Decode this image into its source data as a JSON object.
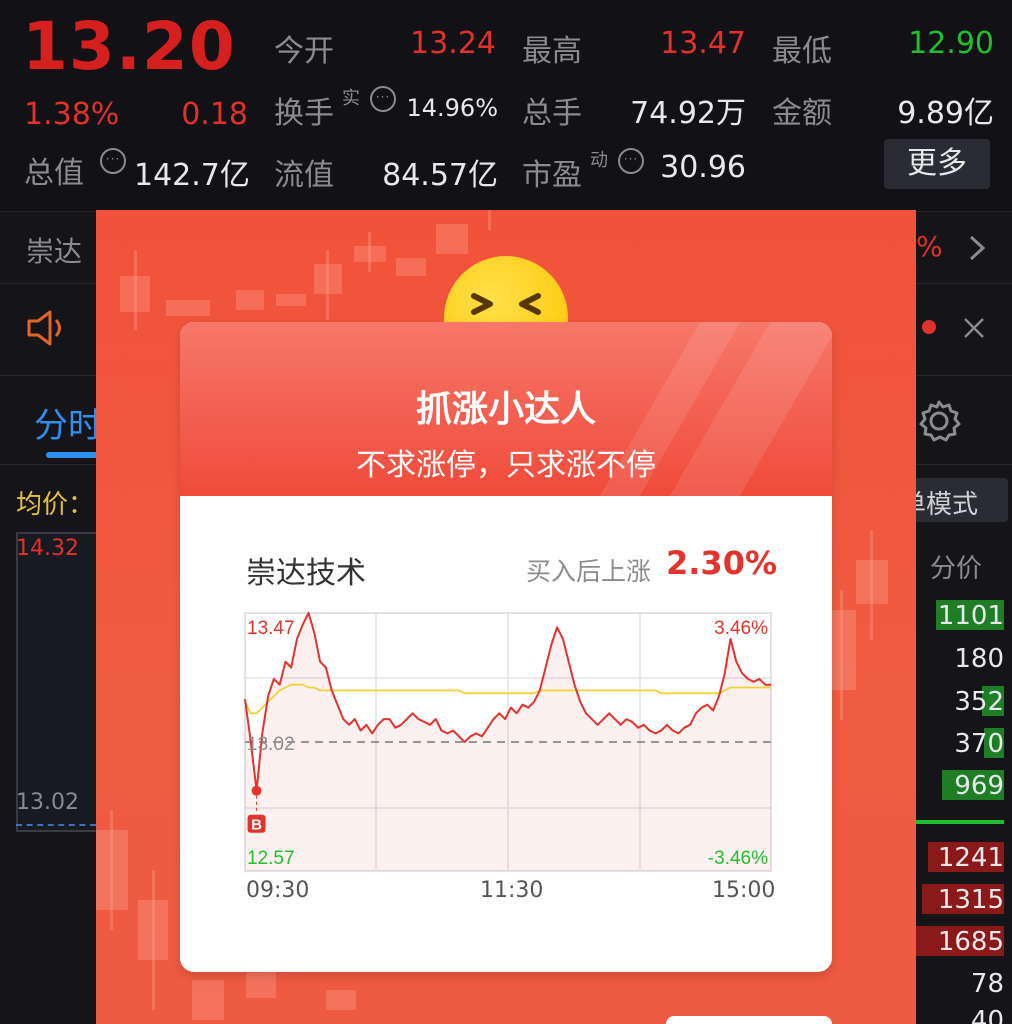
{
  "quote": {
    "price": "13.20",
    "change_pct": "1.38%",
    "change_abs": "0.18",
    "open_label": "今开",
    "open_value": "13.24",
    "high_label": "最高",
    "high_value": "13.47",
    "low_label": "最低",
    "low_value": "12.90",
    "turnover_label": "换手",
    "turnover_sup": "实",
    "turnover_value": "14.96%",
    "volume_label": "总手",
    "volume_value": "74.92万",
    "amount_label": "金额",
    "amount_value": "9.89亿",
    "mktcap_label": "总值",
    "mktcap_value": "142.7亿",
    "float_label": "流值",
    "float_value": "84.57亿",
    "pe_label": "市盈",
    "pe_sup": "动",
    "pe_value": "30.96",
    "more_label": "更多"
  },
  "background": {
    "row1_left": "崇达",
    "row1_right": "%",
    "tab_left": "分时",
    "avg_label": "均价：",
    "mode_label": "单模式",
    "detail_col": "分价",
    "left_price_high": "14.32",
    "left_price_base": "13.02",
    "right_values": [
      "1101",
      "180",
      "352",
      "370",
      "969",
      "1241",
      "1315",
      "1685",
      "78",
      "40"
    ]
  },
  "popup": {
    "title": "抓涨小达人",
    "subtitle": "不求涨停，只求涨不停",
    "stock_name": "崇达技术",
    "gain_label": "买入后上涨",
    "gain_value": "2.30%",
    "buy_marker": "B",
    "colors": {
      "up": "#e2332c",
      "down": "#1fbf2e",
      "avg_line": "#f2d23a"
    }
  },
  "chart_data": {
    "type": "line",
    "x_ticks": [
      "09:30",
      "11:30",
      "15:00"
    ],
    "y_max_label": "13.47",
    "y_min_label": "12.57",
    "y_base_label": "13.02",
    "pct_max_label": "3.46%",
    "pct_min_label": "-3.46%",
    "ylim": [
      12.57,
      13.47
    ],
    "baseline": 13.02,
    "series": [
      {
        "values": [
          13.17,
          13.02,
          12.85,
          13.05,
          13.18,
          13.24,
          13.22,
          13.3,
          13.28,
          13.38,
          13.43,
          13.47,
          13.4,
          13.3,
          13.28,
          13.2,
          13.15,
          13.1,
          13.08,
          13.1,
          13.06,
          13.08,
          13.05,
          13.08,
          13.1,
          13.1,
          13.07,
          13.08,
          13.1,
          13.12,
          13.1,
          13.09,
          13.08,
          13.1,
          13.06,
          13.05,
          13.06,
          13.04,
          13.02,
          13.04,
          13.05,
          13.04,
          13.07,
          13.1,
          13.12,
          13.1,
          13.14,
          13.12,
          13.15,
          13.14,
          13.16,
          13.2,
          13.28,
          13.36,
          13.42,
          13.38,
          13.3,
          13.22,
          13.16,
          13.12,
          13.1,
          13.08,
          13.1,
          13.12,
          13.1,
          13.08,
          13.1,
          13.09,
          13.07,
          13.08,
          13.06,
          13.05,
          13.06,
          13.08,
          13.06,
          13.05,
          13.07,
          13.08,
          13.12,
          13.14,
          13.15,
          13.13,
          13.18,
          13.26,
          13.38,
          13.3,
          13.26,
          13.24,
          13.23,
          13.24,
          13.22,
          13.22
        ]
      },
      {
        "values": [
          13.16,
          13.12,
          13.12,
          13.14,
          13.16,
          13.18,
          13.2,
          13.21,
          13.22,
          13.22,
          13.22,
          13.21,
          13.21,
          13.2,
          13.2,
          13.2,
          13.2,
          13.2,
          13.2,
          13.2,
          13.2,
          13.2,
          13.2,
          13.2,
          13.2,
          13.2,
          13.2,
          13.2,
          13.2,
          13.2,
          13.2,
          13.2,
          13.2,
          13.2,
          13.2,
          13.2,
          13.2,
          13.2,
          13.19,
          13.19,
          13.19,
          13.19,
          13.19,
          13.19,
          13.19,
          13.19,
          13.19,
          13.19,
          13.19,
          13.19,
          13.19,
          13.2,
          13.2,
          13.2,
          13.2,
          13.2,
          13.2,
          13.2,
          13.2,
          13.2,
          13.2,
          13.2,
          13.2,
          13.2,
          13.2,
          13.2,
          13.2,
          13.2,
          13.2,
          13.2,
          13.2,
          13.2,
          13.19,
          13.19,
          13.19,
          13.19,
          13.19,
          13.19,
          13.19,
          13.19,
          13.19,
          13.19,
          13.19,
          13.2,
          13.21,
          13.21,
          13.21,
          13.21,
          13.21,
          13.21,
          13.21,
          13.21
        ]
      }
    ]
  }
}
